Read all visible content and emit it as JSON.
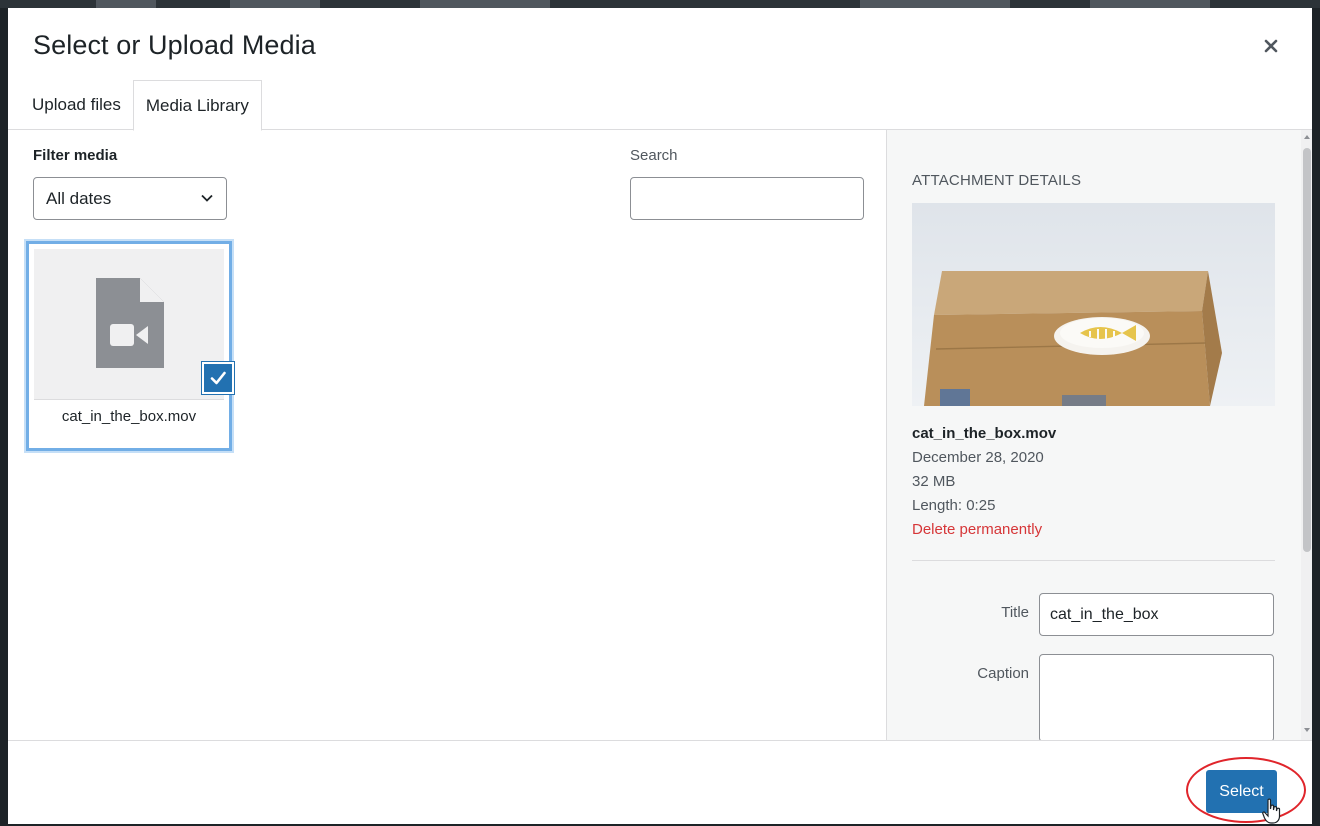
{
  "dialog": {
    "title": "Select or Upload Media",
    "close_icon": "close-icon"
  },
  "tabs": [
    {
      "label": "Upload files",
      "active": false
    },
    {
      "label": "Media Library",
      "active": true
    }
  ],
  "filter": {
    "label": "Filter media",
    "date_value": "All dates",
    "search_label": "Search",
    "search_value": ""
  },
  "attachments": [
    {
      "filename": "cat_in_the_box.mov",
      "selected": true,
      "icon": "video-file-icon"
    }
  ],
  "details": {
    "heading": "Attachment Details",
    "filename": "cat_in_the_box.mov",
    "date": "December 28, 2020",
    "size": "32 MB",
    "length": "Length: 0:25",
    "delete_label": "Delete permanently",
    "title_label": "Title",
    "title_value": "cat_in_the_box",
    "caption_label": "Caption",
    "caption_value": ""
  },
  "toolbar": {
    "select_label": "Select"
  },
  "colors": {
    "accent": "#2271b1",
    "selection_border": "#72aee6",
    "delete": "#d63638",
    "highlight": "#e0252b"
  }
}
